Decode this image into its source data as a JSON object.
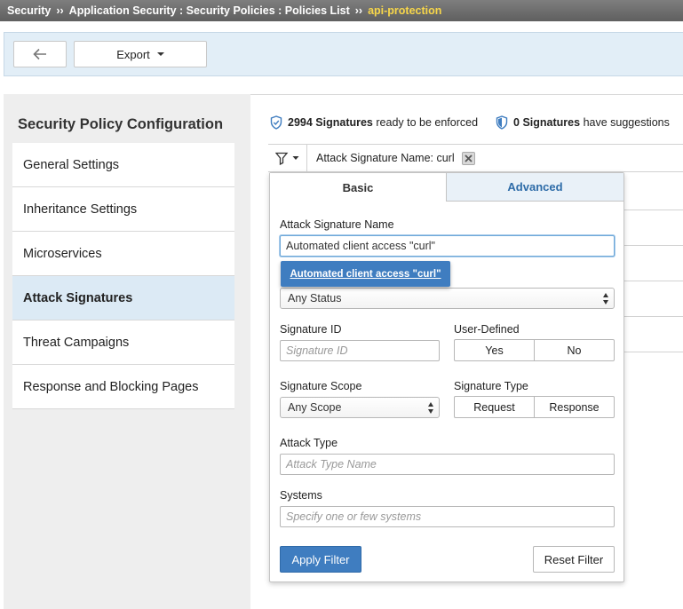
{
  "breadcrumb": {
    "items": [
      "Security",
      "Application Security : Security Policies : Policies List",
      "api-protection"
    ],
    "separator": "››"
  },
  "toolbar": {
    "back_icon": "arrow-left-icon",
    "export_label": "Export"
  },
  "left_panel": {
    "title": "Security Policy Configuration",
    "items": [
      {
        "label": "General Settings"
      },
      {
        "label": "Inheritance Settings"
      },
      {
        "label": "Microservices"
      },
      {
        "label": "Attack Signatures",
        "active": true
      },
      {
        "label": "Threat Campaigns"
      },
      {
        "label": "Response and Blocking Pages"
      }
    ]
  },
  "stats": {
    "enforce_count": "2994 Signatures",
    "enforce_text": "ready to be enforced",
    "suggest_count": "0 Signatures",
    "suggest_text": "have suggestions"
  },
  "filter": {
    "chip_label": "Attack Signature Name: curl"
  },
  "popup": {
    "tabs": {
      "basic": "Basic",
      "advanced": "Advanced"
    },
    "sig_name_label": "Attack Signature Name",
    "sig_name_value": "Automated client access \"curl\"",
    "suggestion": "Automated client access \"curl\"",
    "status_value": "Any Status",
    "sig_id_label": "Signature ID",
    "sig_id_placeholder": "Signature ID",
    "user_defined_label": "User-Defined",
    "user_defined_options": [
      "Yes",
      "No"
    ],
    "scope_label": "Signature Scope",
    "scope_value": "Any Scope",
    "type_label": "Signature Type",
    "type_options": [
      "Request",
      "Response"
    ],
    "attack_type_label": "Attack Type",
    "attack_type_placeholder": "Attack Type Name",
    "systems_label": "Systems",
    "systems_placeholder": "Specify one or few systems",
    "apply_label": "Apply Filter",
    "reset_label": "Reset Filter"
  },
  "colors": {
    "accent": "#3f7dc0",
    "breadcrumb_current": "#f7d64a",
    "active_nav": "#dceaf5"
  }
}
